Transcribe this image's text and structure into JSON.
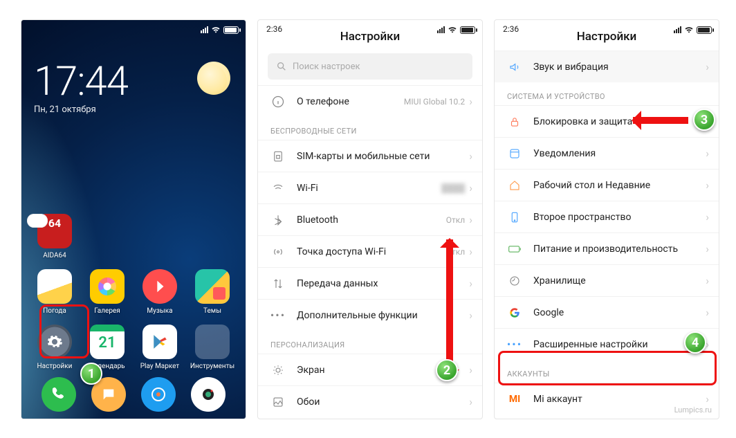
{
  "phone1": {
    "status": {
      "time": ""
    },
    "clock": {
      "time": "17:44",
      "date": "Пн, 21 октября"
    },
    "apps_row1": [
      {
        "id": "aida64",
        "label": "AIDA64"
      }
    ],
    "apps_row2": [
      {
        "id": "weather",
        "label": "Погода"
      },
      {
        "id": "gallery",
        "label": "Галерея"
      },
      {
        "id": "music",
        "label": "Музыка"
      },
      {
        "id": "themes",
        "label": "Темы"
      }
    ],
    "apps_row3": [
      {
        "id": "settings",
        "label": "Настройки"
      },
      {
        "id": "calendar",
        "label": "Календарь",
        "badge": "21"
      },
      {
        "id": "play",
        "label": "Play Маркет"
      },
      {
        "id": "tools",
        "label": "Инструменты"
      }
    ],
    "dock": [
      {
        "id": "phone"
      },
      {
        "id": "messages"
      },
      {
        "id": "browser"
      },
      {
        "id": "camera"
      }
    ]
  },
  "phone2": {
    "status_time": "2:36",
    "title": "Настройки",
    "search_placeholder": "Поиск настроек",
    "about": {
      "label": "О телефоне",
      "value": "MIUI Global 10.2"
    },
    "section_wireless": "БЕСПРОВОДНЫЕ СЕТИ",
    "rows_wireless": [
      {
        "id": "sim",
        "label": "SIM-карты и мобильные сети"
      },
      {
        "id": "wifi",
        "label": "Wi-Fi",
        "value": ""
      },
      {
        "id": "bt",
        "label": "Bluetooth",
        "value": "Откл"
      },
      {
        "id": "hotspot",
        "label": "Точка доступа Wi-Fi",
        "value": "Откл"
      },
      {
        "id": "data",
        "label": "Передача данных"
      },
      {
        "id": "more",
        "label": "Дополнительные функции"
      }
    ],
    "section_personal": "ПЕРСОНАЛИЗАЦИЯ",
    "rows_personal": [
      {
        "id": "display",
        "label": "Экран"
      },
      {
        "id": "wall",
        "label": "Обои"
      }
    ]
  },
  "phone3": {
    "status_time": "2:36",
    "title": "Настройки",
    "row_sound": {
      "label": "Звук и вибрация"
    },
    "section_system": "СИСТЕМА И УСТРОЙСТВО",
    "rows_system": [
      {
        "id": "lock",
        "label": "Блокировка и защита"
      },
      {
        "id": "notif",
        "label": "Уведомления"
      },
      {
        "id": "home",
        "label": "Рабочий стол и Недавние"
      },
      {
        "id": "second",
        "label": "Второе пространство"
      },
      {
        "id": "battery",
        "label": "Питание и производительность"
      },
      {
        "id": "storage",
        "label": "Хранилище"
      },
      {
        "id": "google",
        "label": "Google"
      },
      {
        "id": "advanced",
        "label": "Расширенные настройки"
      }
    ],
    "section_accounts": "АККАУНТЫ",
    "rows_accounts": [
      {
        "id": "mi",
        "label": "Mi аккаунт"
      }
    ]
  },
  "markers": {
    "m1": "1",
    "m2": "2",
    "m3": "3",
    "m4": "4"
  },
  "watermark": "Lumpics.ru"
}
